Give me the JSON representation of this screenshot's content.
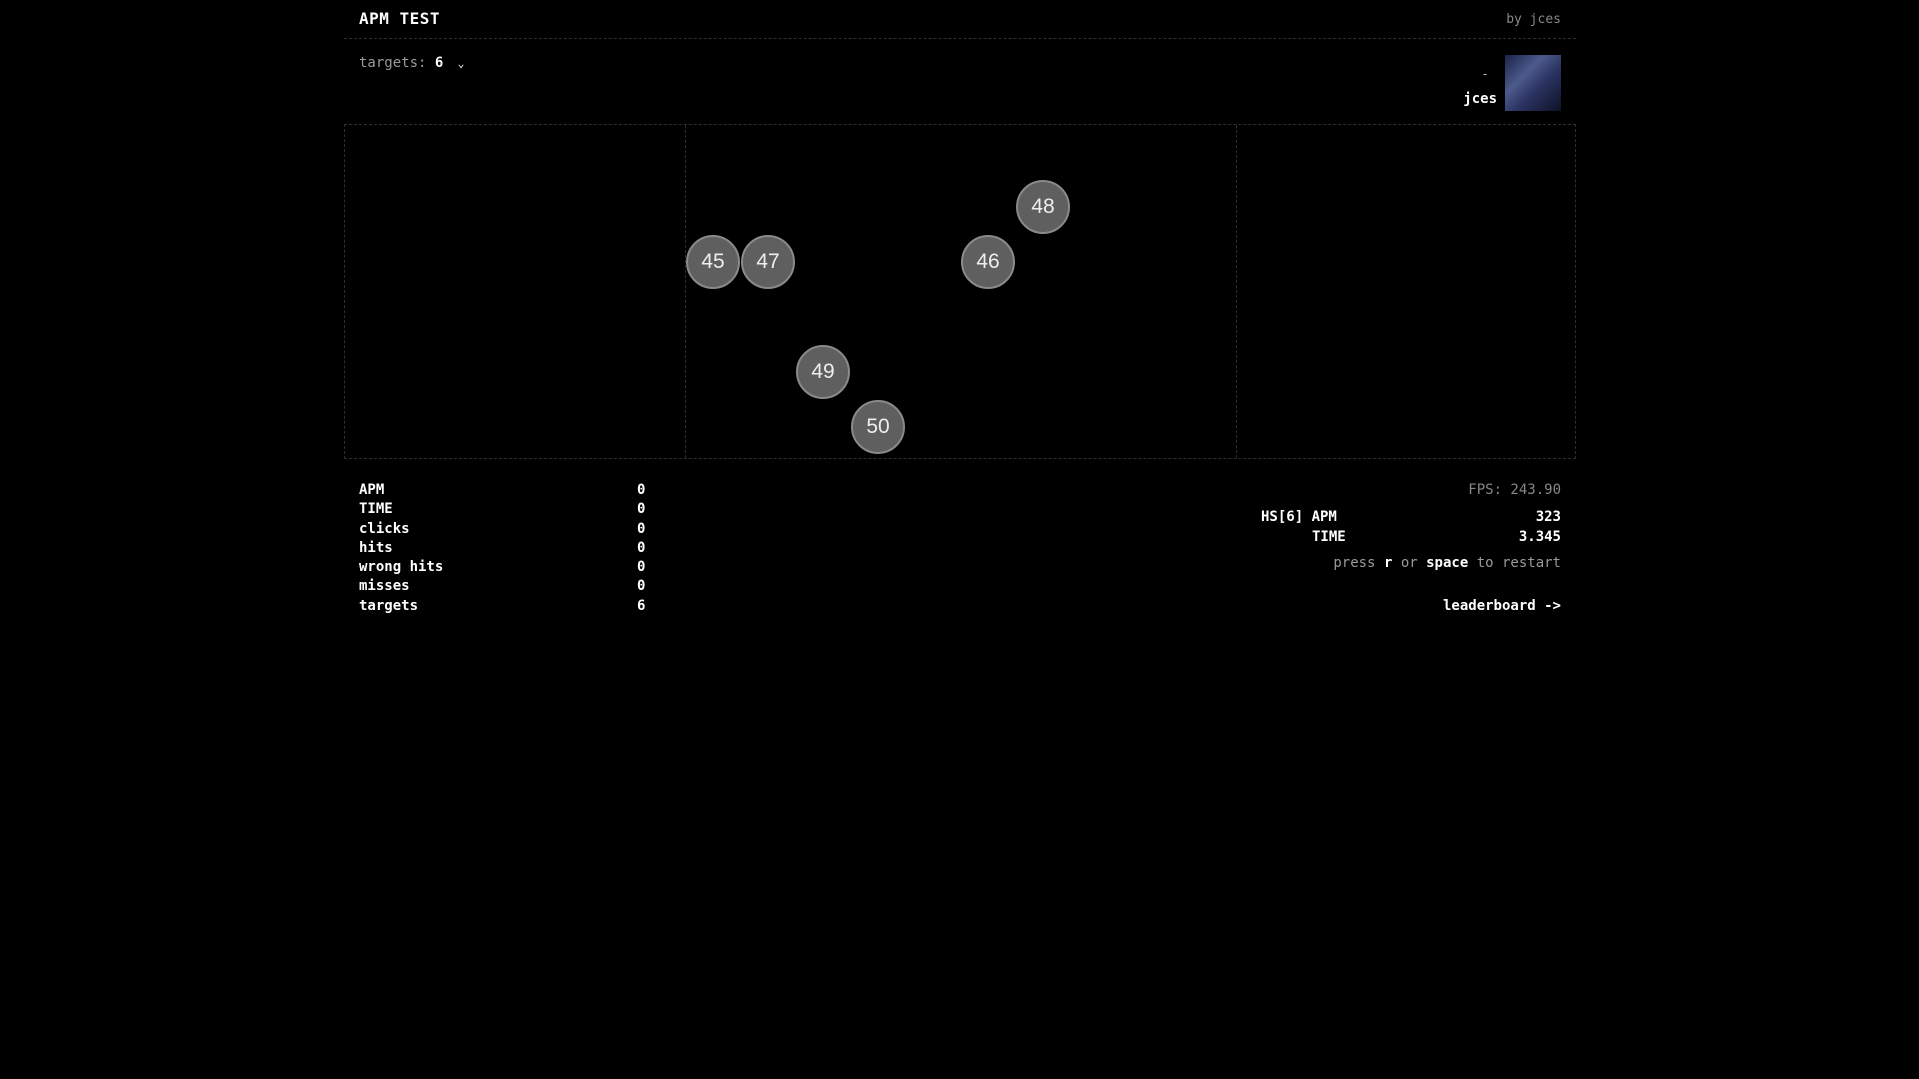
{
  "header": {
    "title": "APM TEST",
    "byline": "by jces"
  },
  "controls": {
    "targets_label": "targets:",
    "targets_value": "6"
  },
  "user": {
    "dash": "-",
    "name": "jces"
  },
  "targets": [
    {
      "number": "45"
    },
    {
      "number": "47"
    },
    {
      "number": "46"
    },
    {
      "number": "48"
    },
    {
      "number": "49"
    },
    {
      "number": "50"
    }
  ],
  "stats": [
    {
      "label": "APM",
      "value": "0"
    },
    {
      "label": "TIME",
      "value": "0"
    },
    {
      "label": "clicks",
      "value": "0"
    },
    {
      "label": "hits",
      "value": "0"
    },
    {
      "label": "wrong hits",
      "value": "0"
    },
    {
      "label": "misses",
      "value": "0"
    },
    {
      "label": "targets",
      "value": "6"
    }
  ],
  "right_panel": {
    "fps": "FPS: 243.90",
    "hs_label": "HS[6] APM",
    "hs_value": "323",
    "time_label": "TIME",
    "time_value": "3.345",
    "restart_press": "press",
    "restart_key1": "r",
    "restart_or": "or",
    "restart_key2": "space",
    "restart_tail": "to restart",
    "leaderboard": "leaderboard ->"
  }
}
